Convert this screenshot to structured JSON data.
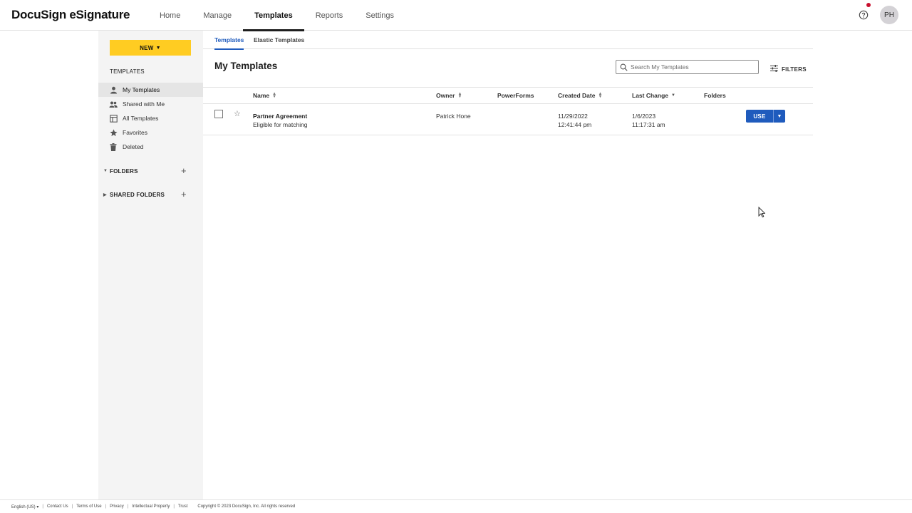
{
  "app": {
    "logo": "DocuSign eSignature",
    "avatar_initials": "PH"
  },
  "nav": [
    {
      "label": "Home"
    },
    {
      "label": "Manage"
    },
    {
      "label": "Templates"
    },
    {
      "label": "Reports"
    },
    {
      "label": "Settings"
    }
  ],
  "sidebar": {
    "new_label": "NEW",
    "heading": "TEMPLATES",
    "items": [
      {
        "label": "My Templates",
        "icon": "person-icon"
      },
      {
        "label": "Shared with Me",
        "icon": "people-icon"
      },
      {
        "label": "All Templates",
        "icon": "template-icon"
      },
      {
        "label": "Favorites",
        "icon": "star-icon"
      },
      {
        "label": "Deleted",
        "icon": "trash-icon"
      }
    ],
    "folders_label": "FOLDERS",
    "shared_folders_label": "SHARED FOLDERS"
  },
  "subtabs": [
    {
      "label": "Templates"
    },
    {
      "label": "Elastic Templates"
    }
  ],
  "main": {
    "title": "My Templates",
    "search_placeholder": "Search My Templates",
    "filters_label": "FILTERS"
  },
  "table": {
    "columns": [
      "Name",
      "Owner",
      "PowerForms",
      "Created Date",
      "Last Change",
      "Folders"
    ],
    "rows": [
      {
        "name": "Partner Agreement",
        "subtitle": "Eligible for matching",
        "owner": "Patrick Hone",
        "powerforms": "",
        "created_date": "11/29/2022",
        "created_time": "12:41:44 pm",
        "last_change_date": "1/6/2023",
        "last_change_time": "11:17:31 am",
        "folders": "",
        "action_label": "USE"
      }
    ]
  },
  "footer": {
    "language": "English (US)",
    "links": [
      "Contact Us",
      "Terms of Use",
      "Privacy",
      "Intellectual Property",
      "Trust"
    ],
    "copyright": "Copyright © 2023 DocuSign, Inc. All rights reserved"
  },
  "colors": {
    "accent": "#1f5bbd",
    "new_button": "#ffcc22",
    "notification": "#c8102e"
  }
}
